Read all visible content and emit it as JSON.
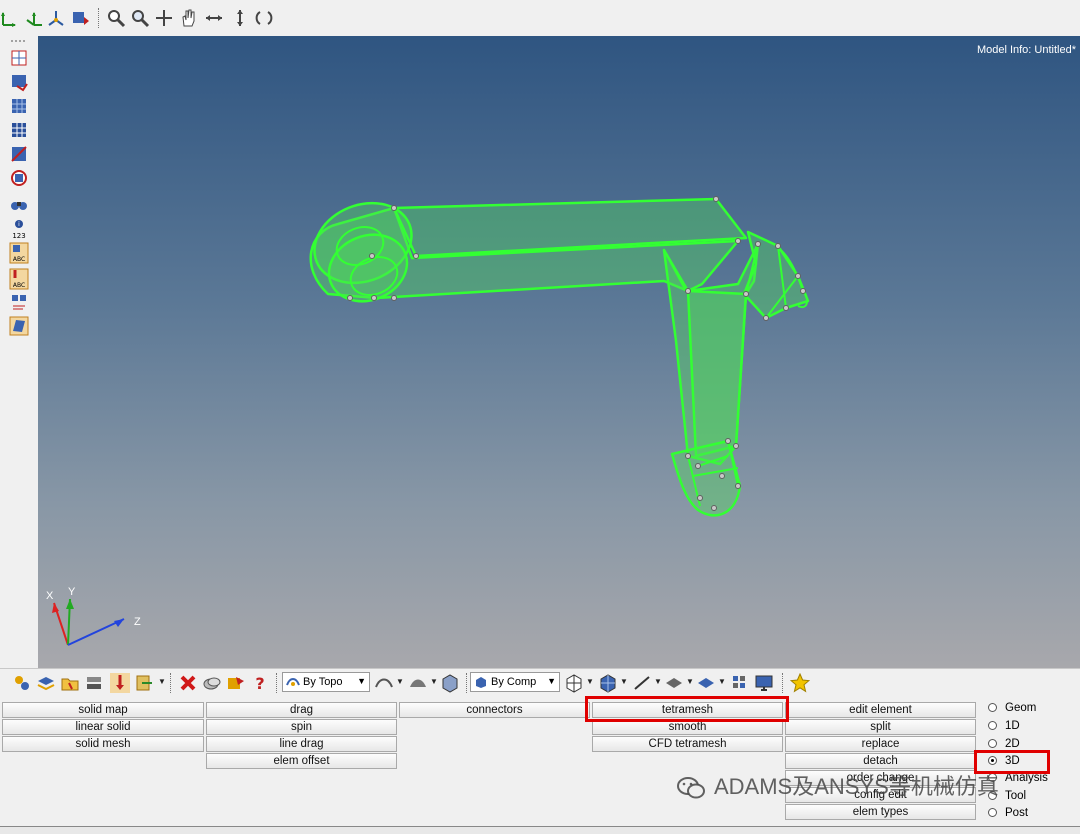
{
  "viewport": {
    "model_info": "Model Info: Untitled*"
  },
  "axis": {
    "x": "X",
    "y": "Y",
    "z": "Z"
  },
  "bottom_toolbar": {
    "topo_dropdown": {
      "value": "By Topo"
    },
    "comp_dropdown": {
      "value": "By Comp"
    }
  },
  "menu": {
    "col1": [
      "solid map",
      "linear solid",
      "solid mesh"
    ],
    "col2": [
      "drag",
      "spin",
      "line drag",
      "elem offset"
    ],
    "col3": [
      "connectors"
    ],
    "col4": [
      "tetramesh",
      "smooth",
      "CFD tetramesh"
    ],
    "col5": [
      "edit element",
      "split",
      "replace",
      "detach",
      "order change",
      "config edit",
      "elem types"
    ],
    "radios": [
      {
        "label": "Geom",
        "selected": false
      },
      {
        "label": "1D",
        "selected": false
      },
      {
        "label": "2D",
        "selected": false
      },
      {
        "label": "3D",
        "selected": true
      },
      {
        "label": "Analysis",
        "selected": false
      },
      {
        "label": "Tool",
        "selected": false
      },
      {
        "label": "Post",
        "selected": false
      }
    ]
  },
  "watermark": {
    "text": "ADAMS及ANSYS等机械仿真"
  },
  "colors": {
    "mesh_green": "#33ff33",
    "highlight_red": "#e00000",
    "viewport_top": "#2f5581",
    "viewport_bottom": "#a8a8ac"
  }
}
